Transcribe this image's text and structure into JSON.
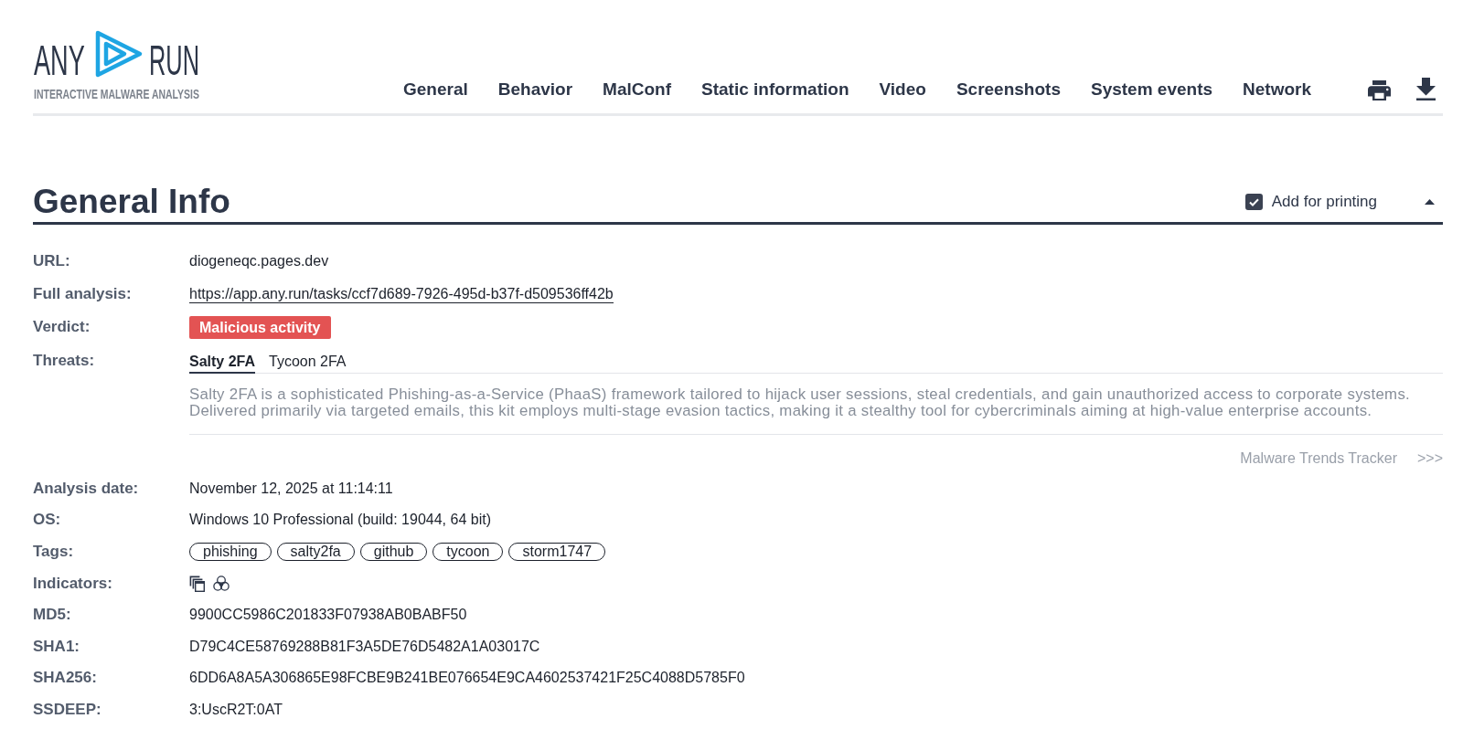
{
  "logo": {
    "left_word": "ANY",
    "right_word": "RUN",
    "tagline": "INTERACTIVE MALWARE ANALYSIS"
  },
  "nav": [
    {
      "label": "General"
    },
    {
      "label": "Behavior"
    },
    {
      "label": "MalConf"
    },
    {
      "label": "Static information"
    },
    {
      "label": "Video"
    },
    {
      "label": "Screenshots"
    },
    {
      "label": "System events"
    },
    {
      "label": "Network"
    }
  ],
  "section": {
    "title": "General Info",
    "print_checkbox": {
      "label": "Add for printing",
      "checked": true
    },
    "expanded": true
  },
  "rows": [
    {
      "kind": "text",
      "label": "URL:",
      "value": "diogeneqc.pages.dev"
    },
    {
      "kind": "link",
      "label": "Full analysis:",
      "value": "https://app.any.run/tasks/ccf7d689-7926-495d-b37f-d509536ff42b"
    },
    {
      "kind": "verdict",
      "label": "Verdict:",
      "value": "Malicious activity"
    },
    {
      "kind": "threats",
      "label": "Threats:",
      "tabs": [
        {
          "label": "Salty 2FA",
          "selected": true
        },
        {
          "label": "Tycoon 2FA",
          "selected": false
        }
      ],
      "description": "Salty 2FA is a sophisticated Phishing-as-a-Service (PhaaS) framework tailored to hijack user sessions, steal credentials, and gain unauthorized access to corporate systems. Delivered primarily via targeted emails, this kit employs multi-stage evasion tactics, making it a stealthy tool for cybercriminals aiming at high-value enterprise accounts.",
      "tracker_link": {
        "label": "Malware Trends Tracker",
        "arrow": ">>>"
      }
    },
    {
      "kind": "text",
      "label": "Analysis date:",
      "value": "November 12, 2025 at 11:14:11"
    },
    {
      "kind": "text",
      "label": "OS:",
      "value": "Windows 10 Professional (build: 19044, 64 bit)"
    },
    {
      "kind": "tags",
      "label": "Tags:",
      "tags": [
        "phishing",
        "salty2fa",
        "github",
        "tycoon",
        "storm1747"
      ]
    },
    {
      "kind": "indicators",
      "label": "Indicators:"
    },
    {
      "kind": "text",
      "label": "MD5:",
      "value": "9900CC5986C201833F07938AB0BABF50"
    },
    {
      "kind": "text",
      "label": "SHA1:",
      "value": "D79C4CE58769288B81F3A5DE76D5482A1A03017C"
    },
    {
      "kind": "text",
      "label": "SHA256:",
      "value": "6DD6A8A5A306865E98FCBE9B241BE076654E9CA4602537421F25C4088D5785F0"
    },
    {
      "kind": "text",
      "label": "SSDEEP:",
      "value": "3:UscR2T:0AT"
    }
  ]
}
